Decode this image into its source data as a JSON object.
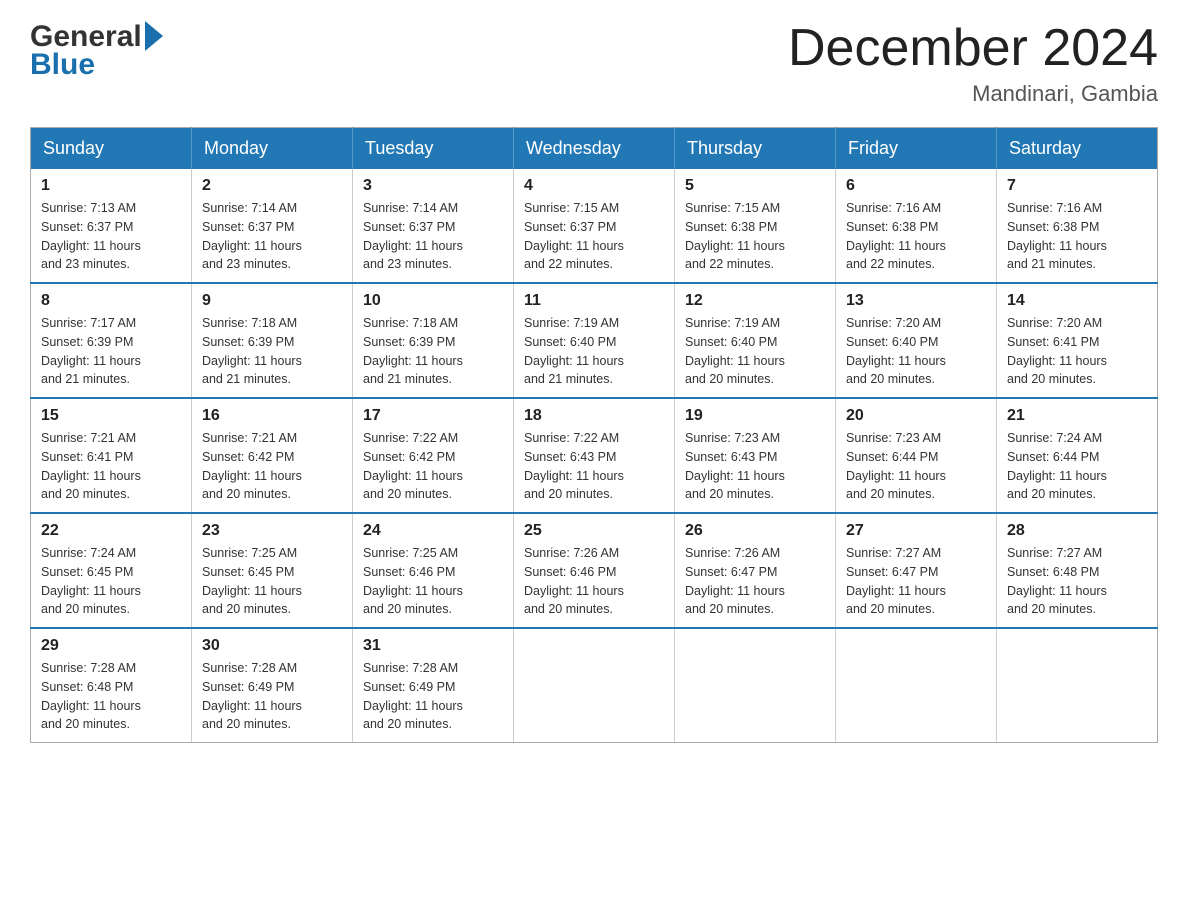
{
  "header": {
    "logo_general": "General",
    "logo_blue": "Blue",
    "month_title": "December 2024",
    "location": "Mandinari, Gambia"
  },
  "days_of_week": [
    "Sunday",
    "Monday",
    "Tuesday",
    "Wednesday",
    "Thursday",
    "Friday",
    "Saturday"
  ],
  "weeks": [
    [
      {
        "day": "1",
        "sunrise": "7:13 AM",
        "sunset": "6:37 PM",
        "daylight": "11 hours and 23 minutes."
      },
      {
        "day": "2",
        "sunrise": "7:14 AM",
        "sunset": "6:37 PM",
        "daylight": "11 hours and 23 minutes."
      },
      {
        "day": "3",
        "sunrise": "7:14 AM",
        "sunset": "6:37 PM",
        "daylight": "11 hours and 23 minutes."
      },
      {
        "day": "4",
        "sunrise": "7:15 AM",
        "sunset": "6:37 PM",
        "daylight": "11 hours and 22 minutes."
      },
      {
        "day": "5",
        "sunrise": "7:15 AM",
        "sunset": "6:38 PM",
        "daylight": "11 hours and 22 minutes."
      },
      {
        "day": "6",
        "sunrise": "7:16 AM",
        "sunset": "6:38 PM",
        "daylight": "11 hours and 22 minutes."
      },
      {
        "day": "7",
        "sunrise": "7:16 AM",
        "sunset": "6:38 PM",
        "daylight": "11 hours and 21 minutes."
      }
    ],
    [
      {
        "day": "8",
        "sunrise": "7:17 AM",
        "sunset": "6:39 PM",
        "daylight": "11 hours and 21 minutes."
      },
      {
        "day": "9",
        "sunrise": "7:18 AM",
        "sunset": "6:39 PM",
        "daylight": "11 hours and 21 minutes."
      },
      {
        "day": "10",
        "sunrise": "7:18 AM",
        "sunset": "6:39 PM",
        "daylight": "11 hours and 21 minutes."
      },
      {
        "day": "11",
        "sunrise": "7:19 AM",
        "sunset": "6:40 PM",
        "daylight": "11 hours and 21 minutes."
      },
      {
        "day": "12",
        "sunrise": "7:19 AM",
        "sunset": "6:40 PM",
        "daylight": "11 hours and 20 minutes."
      },
      {
        "day": "13",
        "sunrise": "7:20 AM",
        "sunset": "6:40 PM",
        "daylight": "11 hours and 20 minutes."
      },
      {
        "day": "14",
        "sunrise": "7:20 AM",
        "sunset": "6:41 PM",
        "daylight": "11 hours and 20 minutes."
      }
    ],
    [
      {
        "day": "15",
        "sunrise": "7:21 AM",
        "sunset": "6:41 PM",
        "daylight": "11 hours and 20 minutes."
      },
      {
        "day": "16",
        "sunrise": "7:21 AM",
        "sunset": "6:42 PM",
        "daylight": "11 hours and 20 minutes."
      },
      {
        "day": "17",
        "sunrise": "7:22 AM",
        "sunset": "6:42 PM",
        "daylight": "11 hours and 20 minutes."
      },
      {
        "day": "18",
        "sunrise": "7:22 AM",
        "sunset": "6:43 PM",
        "daylight": "11 hours and 20 minutes."
      },
      {
        "day": "19",
        "sunrise": "7:23 AM",
        "sunset": "6:43 PM",
        "daylight": "11 hours and 20 minutes."
      },
      {
        "day": "20",
        "sunrise": "7:23 AM",
        "sunset": "6:44 PM",
        "daylight": "11 hours and 20 minutes."
      },
      {
        "day": "21",
        "sunrise": "7:24 AM",
        "sunset": "6:44 PM",
        "daylight": "11 hours and 20 minutes."
      }
    ],
    [
      {
        "day": "22",
        "sunrise": "7:24 AM",
        "sunset": "6:45 PM",
        "daylight": "11 hours and 20 minutes."
      },
      {
        "day": "23",
        "sunrise": "7:25 AM",
        "sunset": "6:45 PM",
        "daylight": "11 hours and 20 minutes."
      },
      {
        "day": "24",
        "sunrise": "7:25 AM",
        "sunset": "6:46 PM",
        "daylight": "11 hours and 20 minutes."
      },
      {
        "day": "25",
        "sunrise": "7:26 AM",
        "sunset": "6:46 PM",
        "daylight": "11 hours and 20 minutes."
      },
      {
        "day": "26",
        "sunrise": "7:26 AM",
        "sunset": "6:47 PM",
        "daylight": "11 hours and 20 minutes."
      },
      {
        "day": "27",
        "sunrise": "7:27 AM",
        "sunset": "6:47 PM",
        "daylight": "11 hours and 20 minutes."
      },
      {
        "day": "28",
        "sunrise": "7:27 AM",
        "sunset": "6:48 PM",
        "daylight": "11 hours and 20 minutes."
      }
    ],
    [
      {
        "day": "29",
        "sunrise": "7:28 AM",
        "sunset": "6:48 PM",
        "daylight": "11 hours and 20 minutes."
      },
      {
        "day": "30",
        "sunrise": "7:28 AM",
        "sunset": "6:49 PM",
        "daylight": "11 hours and 20 minutes."
      },
      {
        "day": "31",
        "sunrise": "7:28 AM",
        "sunset": "6:49 PM",
        "daylight": "11 hours and 20 minutes."
      },
      null,
      null,
      null,
      null
    ]
  ],
  "labels": {
    "sunrise": "Sunrise:",
    "sunset": "Sunset:",
    "daylight": "Daylight:"
  }
}
